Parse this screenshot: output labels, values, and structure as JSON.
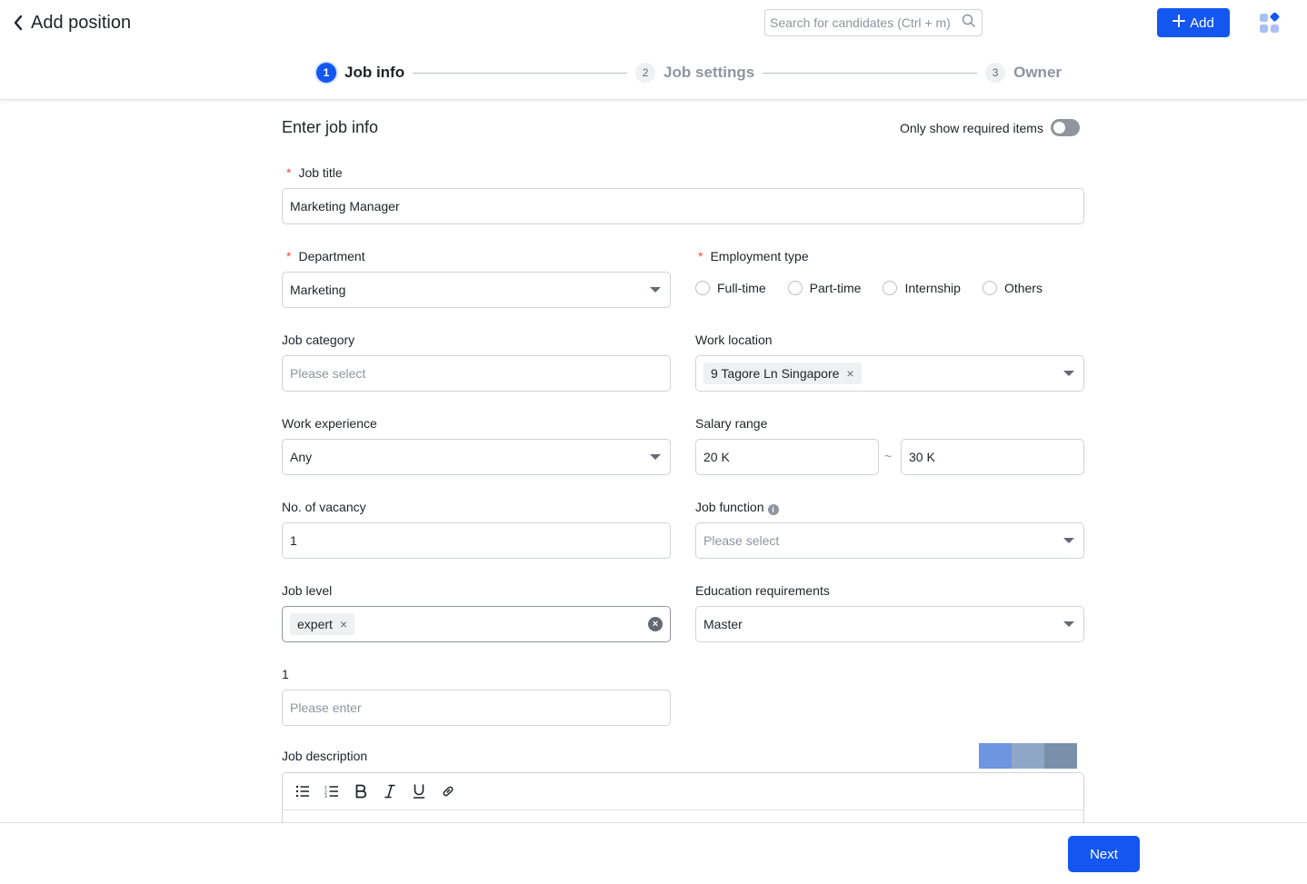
{
  "header": {
    "title": "Add position",
    "search_placeholder": "Search for candidates (Ctrl + m)",
    "add_label": "Add"
  },
  "steps": [
    {
      "num": "1",
      "label": "Job info",
      "state": "active"
    },
    {
      "num": "2",
      "label": "Job settings",
      "state": "todo"
    },
    {
      "num": "3",
      "label": "Owner",
      "state": "todo"
    }
  ],
  "form": {
    "section_title": "Enter job info",
    "toggle_label": "Only show required items",
    "job_title": {
      "label": "Job title",
      "value": "Marketing Manager"
    },
    "department": {
      "label": "Department",
      "value": "Marketing"
    },
    "employment_type": {
      "label": "Employment type",
      "options": [
        "Full-time",
        "Part-time",
        "Internship",
        "Others"
      ]
    },
    "job_category": {
      "label": "Job category",
      "placeholder": "Please select"
    },
    "work_location": {
      "label": "Work location",
      "tag": "9 Tagore Ln Singapore"
    },
    "work_experience": {
      "label": "Work experience",
      "value": "Any"
    },
    "salary_range": {
      "label": "Salary range",
      "min": "20 K",
      "separator": "~",
      "max": "30 K"
    },
    "vacancy": {
      "label": "No. of vacancy",
      "value": "1"
    },
    "job_function": {
      "label": "Job function",
      "placeholder": "Please select"
    },
    "job_level": {
      "label": "Job level",
      "tag": "expert"
    },
    "education": {
      "label": "Education requirements",
      "value": "Master"
    },
    "custom_field": {
      "label": "1",
      "placeholder": "Please enter"
    },
    "job_description": {
      "label": "Job description"
    }
  },
  "footer": {
    "next_label": "Next"
  },
  "colors": {
    "primary": "#1456f0",
    "required": "#f54a45"
  }
}
